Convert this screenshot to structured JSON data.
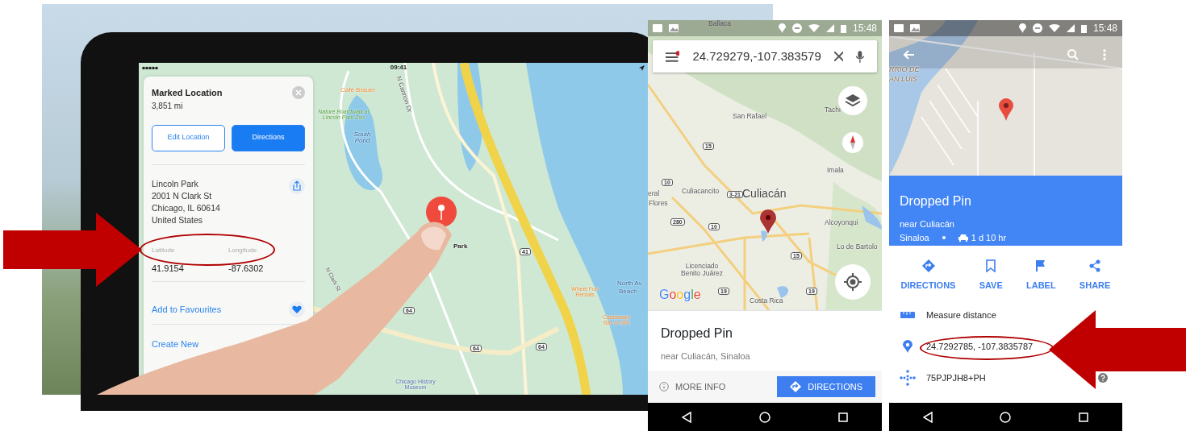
{
  "tablet": {
    "status_time": "09:41",
    "place_card": {
      "title": "Marked Location",
      "distance": "3,851 mi",
      "buttons": [
        {
          "label": "Edit Location",
          "kind": "outline"
        },
        {
          "label": "Directions",
          "kind": "filled"
        }
      ],
      "address_lines": [
        "Lincoln Park",
        "2001 N Clark St",
        "Chicago, IL  60614",
        "United States"
      ],
      "coordinates": [
        {
          "label": "Latitude",
          "value": "41.9154"
        },
        {
          "label": "Longitude",
          "value": "-87.6302"
        }
      ],
      "actions": [
        {
          "label": "Add to Favourites",
          "kind": "favourite"
        },
        {
          "label": "Create New",
          "kind": "create"
        }
      ]
    },
    "map_labels": [
      {
        "text": "Café Brauer",
        "kind": "poi"
      },
      {
        "text": "Nature Boardwalk at Lincoln Park Zoo",
        "kind": "park"
      },
      {
        "text": "South Pond",
        "kind": "water"
      },
      {
        "text": "N Cannon Dr",
        "kind": "street"
      },
      {
        "text": "N Clark St",
        "kind": "street"
      },
      {
        "text": "Chicago History Museum",
        "kind": "museum"
      },
      {
        "text": "Wheel Fun Rentals",
        "kind": "poi"
      },
      {
        "text": "North Av",
        "kind": "beach"
      },
      {
        "text": "Beach",
        "kind": "beach"
      },
      {
        "text": "Castaways Bar & Grill",
        "kind": "poi"
      },
      {
        "text": "Park",
        "kind": "pin"
      },
      {
        "text": "41",
        "kind": "shield"
      },
      {
        "text": "64",
        "kind": "shield"
      },
      {
        "text": "64",
        "kind": "shield"
      },
      {
        "text": "64",
        "kind": "shield"
      }
    ]
  },
  "search_phone": {
    "status_time": "15:48",
    "search_value": "24.729279,-107.383579",
    "map_labels": [
      {
        "text": "Ballaca",
        "kind": "town"
      },
      {
        "text": "San Rafael",
        "kind": "town"
      },
      {
        "text": "Tachi",
        "kind": "town"
      },
      {
        "text": "Imala",
        "kind": "town"
      },
      {
        "text": "eral",
        "kind": "town"
      },
      {
        "text": "Flores",
        "kind": "town"
      },
      {
        "text": "Culiacancito",
        "kind": "town"
      },
      {
        "text": "Culiacán",
        "kind": "city"
      },
      {
        "text": "Alcoyonqui",
        "kind": "town"
      },
      {
        "text": "Lo de Bartolo",
        "kind": "town"
      },
      {
        "text": "Licenciado Benito Juárez",
        "kind": "town"
      },
      {
        "text": "Google",
        "kind": "logo"
      },
      {
        "text": "Costa Rica",
        "kind": "town"
      },
      {
        "text": "15",
        "kind": "shield"
      },
      {
        "text": "3-21",
        "kind": "shield"
      },
      {
        "text": "10",
        "kind": "shield"
      },
      {
        "text": "280",
        "kind": "shield"
      },
      {
        "text": "10",
        "kind": "shield"
      },
      {
        "text": "15",
        "kind": "shield"
      },
      {
        "text": "19",
        "kind": "shield"
      },
      {
        "text": "19",
        "kind": "shield"
      }
    ],
    "place": {
      "title": "Dropped Pin",
      "subtitle": "near Culiacán, Sinaloa"
    },
    "actions": [
      {
        "label": "MORE INFO",
        "kind": "text"
      },
      {
        "label": "DIRECTIONS",
        "kind": "primary"
      }
    ]
  },
  "details_phone": {
    "status_time": "15:48",
    "map_labels": [
      {
        "text": "RRIO DE",
        "kind": "district"
      },
      {
        "text": "AN LUIS",
        "kind": "district"
      }
    ],
    "header": {
      "title": "Dropped Pin",
      "line_1": "near Culiacán",
      "line_2": "Sinaloa",
      "travel_time": "1 d 10 hr"
    },
    "actions": [
      {
        "label": "DIRECTIONS",
        "kind": "directions"
      },
      {
        "label": "SAVE",
        "kind": "save"
      },
      {
        "label": "LABEL",
        "kind": "label"
      },
      {
        "label": "SHARE",
        "kind": "share"
      }
    ],
    "rows": [
      {
        "kind": "measure",
        "text": "Measure distance"
      },
      {
        "kind": "coordinates",
        "text": "24.7292785, -107.3835787"
      },
      {
        "kind": "plus_code",
        "text": "75PJPJH8+PH"
      }
    ]
  }
}
